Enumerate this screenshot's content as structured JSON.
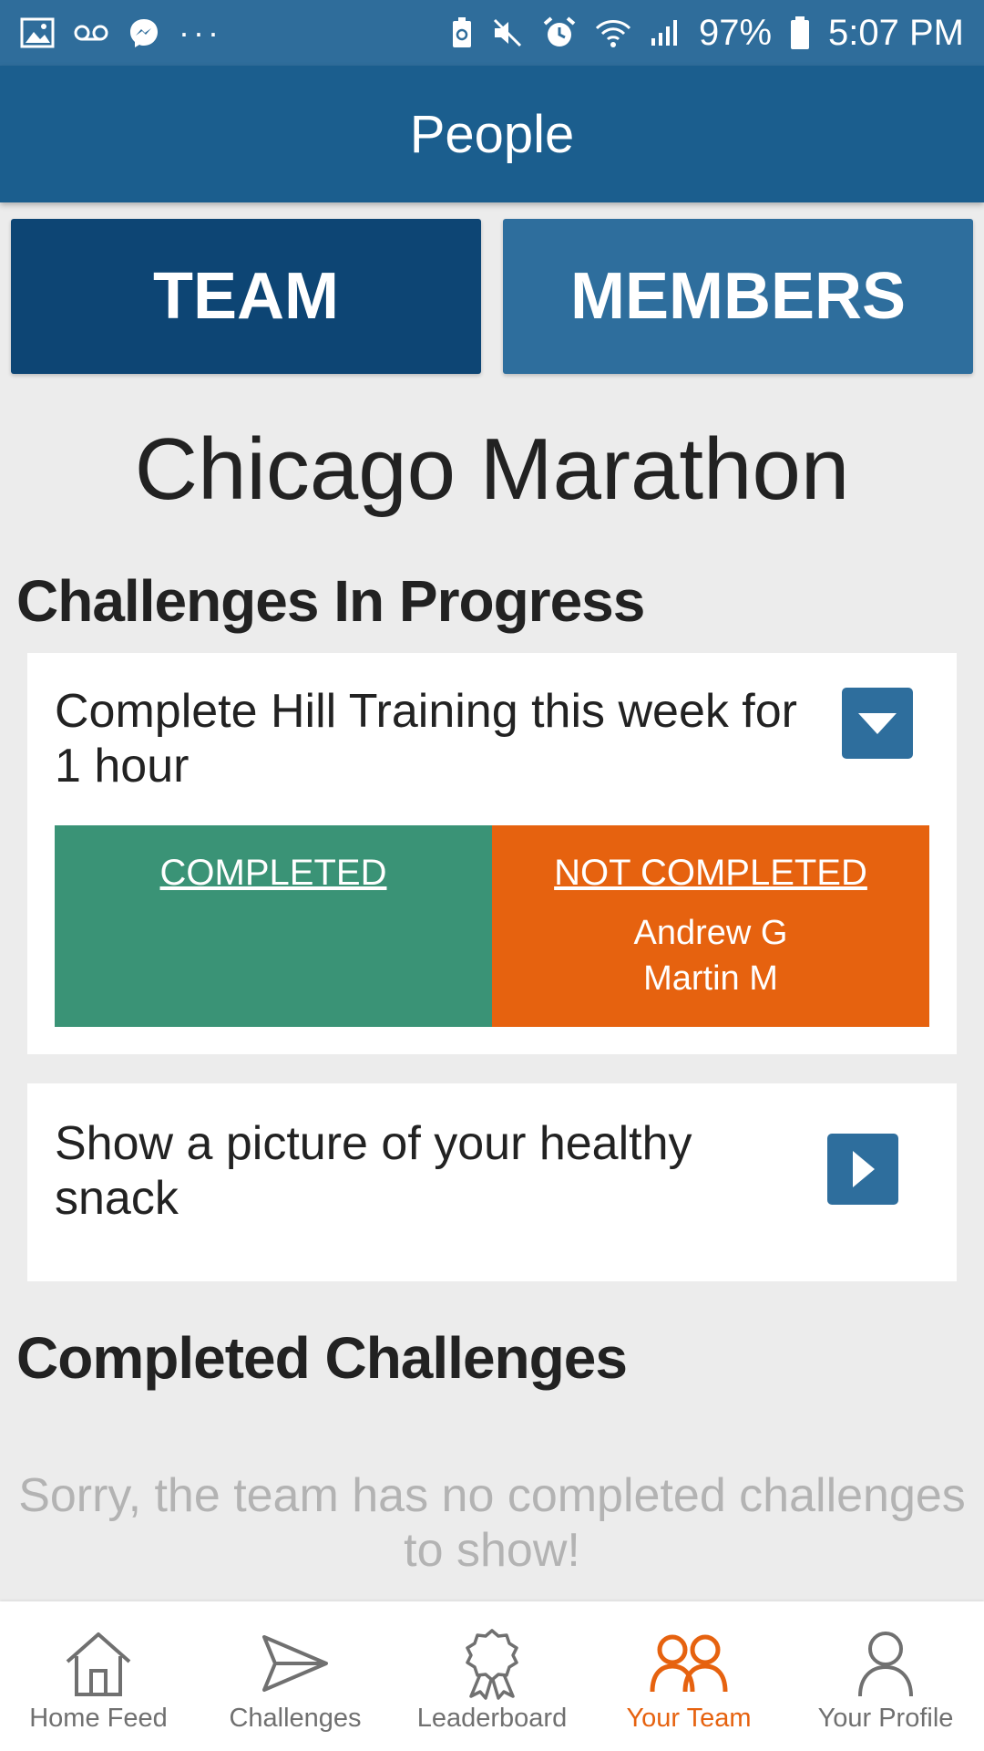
{
  "status_bar": {
    "left_icons": [
      "image-icon",
      "voicemail-icon",
      "messenger-icon"
    ],
    "overflow": "···",
    "right_icons": [
      "battery-saver-icon",
      "mute-icon",
      "alarm-icon",
      "wifi-icon",
      "signal-icon"
    ],
    "battery": "97%",
    "time": "5:07 PM"
  },
  "app_bar": {
    "title": "People"
  },
  "tabs": {
    "team": "TEAM",
    "members": "MEMBERS"
  },
  "team_name": "Chicago Marathon",
  "sections": {
    "in_progress": "Challenges In Progress",
    "completed": "Completed Challenges"
  },
  "challenges": [
    {
      "title": "Complete Hill Training this week for 1 hour",
      "completed_label": "COMPLETED",
      "not_completed_label": "NOT COMPLETED",
      "completed_members": [],
      "not_completed_members": [
        "Andrew G",
        "Martin M"
      ],
      "toggle_icon": "caret-down-icon"
    },
    {
      "title": "Show a picture of your healthy snack",
      "toggle_icon": "caret-right-icon"
    }
  ],
  "empty_completed_message": "Sorry, the team has no completed challenges to show!",
  "bottom_nav": [
    {
      "label": "Home Feed",
      "icon": "home-icon",
      "active": false
    },
    {
      "label": "Challenges",
      "icon": "send-icon",
      "active": false
    },
    {
      "label": "Leaderboard",
      "icon": "award-icon",
      "active": false
    },
    {
      "label": "Your Team",
      "icon": "team-icon",
      "active": true
    },
    {
      "label": "Your Profile",
      "icon": "profile-icon",
      "active": false
    }
  ],
  "colors": {
    "status_bar": "#2f6d9b",
    "app_bar": "#1b5e8e",
    "tab_active": "#0d4574",
    "tab_inactive": "#2e6e9d",
    "completed": "#3a9376",
    "not_completed": "#e6620f",
    "nav_active": "#e6620f"
  }
}
